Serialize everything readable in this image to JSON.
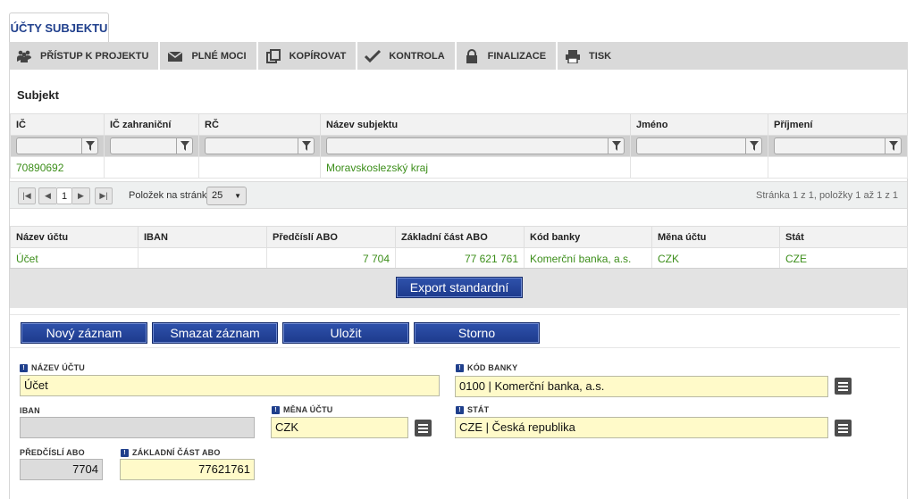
{
  "tab": {
    "label": "ÚČTY SUBJEKTU"
  },
  "toolbar": [
    {
      "label": "PŘÍSTUP K PROJEKTU",
      "icon": "people-icon"
    },
    {
      "label": "PLNÉ MOCI",
      "icon": "envelope-icon"
    },
    {
      "label": "KOPÍROVAT",
      "icon": "copy-icon"
    },
    {
      "label": "KONTROLA",
      "icon": "check-icon"
    },
    {
      "label": "FINALIZACE",
      "icon": "lock-icon"
    },
    {
      "label": "TISK",
      "icon": "printer-icon"
    }
  ],
  "subjekt": {
    "title": "Subjekt",
    "columns": [
      "IČ",
      "IČ zahraniční",
      "RČ",
      "Název subjektu",
      "Jméno",
      "Příjmení"
    ],
    "row": [
      "70890692",
      "",
      "",
      "Moravskoslezský kraj",
      "",
      ""
    ]
  },
  "pager": {
    "current_page": "1",
    "per_page_label": "Položek na stránku",
    "per_page_value": "25",
    "info": "Stránka 1 z 1, položky 1 až 1 z 1"
  },
  "accounts": {
    "columns": [
      "Název účtu",
      "IBAN",
      "Předčíslí ABO",
      "Základní část ABO",
      "Kód banky",
      "Měna účtu",
      "Stát"
    ],
    "row": [
      "Účet",
      "",
      "7 704",
      "77 621 761",
      "Komerční banka, a.s.",
      "CZK",
      "CZE"
    ]
  },
  "export_label": "Export standardní",
  "actions": {
    "new": "Nový záznam",
    "delete": "Smazat záznam",
    "save": "Uložit",
    "cancel": "Storno"
  },
  "form": {
    "nazev_uctu_label": "NÁZEV ÚČTU",
    "nazev_uctu_value": "Účet",
    "kod_banky_label": "KÓD BANKY",
    "kod_banky_value": "0100 | Komerční banka, a.s.",
    "iban_label": "IBAN",
    "iban_value": "",
    "mena_label": "MĚNA ÚČTU",
    "mena_value": "CZK",
    "stat_label": "STÁT",
    "stat_value": "CZE | Česká republika",
    "predcisli_label": "PŘEDČÍSLÍ ABO",
    "predcisli_value": "7704",
    "zakladni_label": "ZÁKLADNÍ ČÁST ABO",
    "zakladni_value": "77621761",
    "required_marker": "!"
  },
  "colors": {
    "accent": "#1f3f8c",
    "link_green": "#3c8e1a",
    "required_field_bg": "#fffac9"
  }
}
